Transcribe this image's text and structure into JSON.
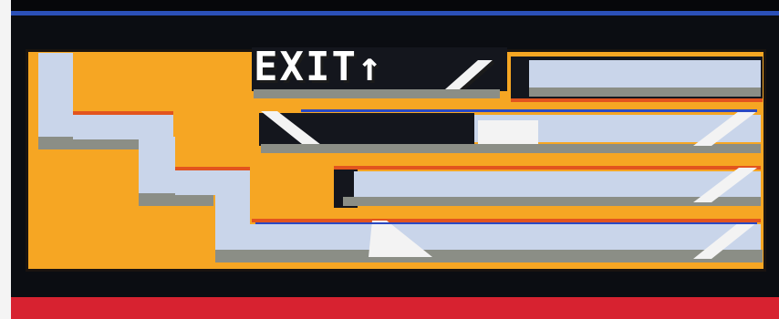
{
  "sign": {
    "text": "EXIT↑"
  },
  "colors": {
    "floor": "#f6a623",
    "wall": "#c9d5ea",
    "shadow": "#8b8e86",
    "edge": "#e2541e",
    "dark": "#14161d",
    "top_bar": "#2b50b8",
    "bottom_bar": "#d72230"
  },
  "icons": [
    "ramp-icon",
    "up-arrow-icon"
  ]
}
